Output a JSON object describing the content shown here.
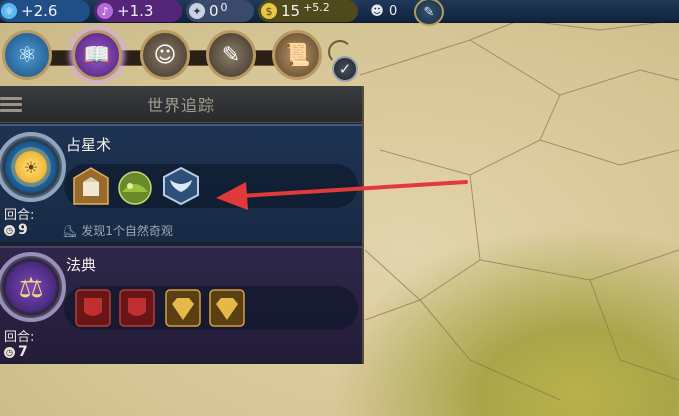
{
  "topbar": {
    "science": {
      "icon": "science-icon",
      "value": "+2.6"
    },
    "culture": {
      "icon": "culture-icon",
      "value": "+1.3"
    },
    "faith": {
      "icon": "faith-icon",
      "value": "0",
      "sub": "0"
    },
    "gold": {
      "icon": "gold-icon",
      "value": "15",
      "sub": "+5.2"
    },
    "population": {
      "icon": "population-icon",
      "value": "0"
    },
    "government": {
      "icon": "government-icon",
      "glyph": "✎"
    }
  },
  "launch_bar": {
    "buttons": [
      {
        "name": "science-tree-button",
        "glyph": "⚛"
      },
      {
        "name": "civics-tree-button",
        "glyph": "📖"
      },
      {
        "name": "great-people-button",
        "glyph": "☺"
      },
      {
        "name": "great-works-button",
        "glyph": "✎"
      },
      {
        "name": "religion-button",
        "glyph": "📜"
      }
    ],
    "check_glyph": "✓"
  },
  "world_tracker": {
    "title": "世界追踪",
    "research": {
      "name": "占星术",
      "turns_label": "回合:",
      "turns": "9",
      "hint": "发现1个自然奇观",
      "unlocks": [
        "building-icon",
        "natural-wonder-icon",
        "wings-icon"
      ]
    },
    "civic": {
      "name": "法典",
      "turns_label": "回合:",
      "turns": "7",
      "unlocks": [
        "red-shield-icon",
        "red-shield-icon",
        "gold-diamond-icon",
        "gold-diamond-icon"
      ]
    }
  },
  "colors": {
    "arrow": "#e23a3a",
    "research_accent": "#2a8ad0",
    "civic_accent": "#7a4ab8"
  }
}
